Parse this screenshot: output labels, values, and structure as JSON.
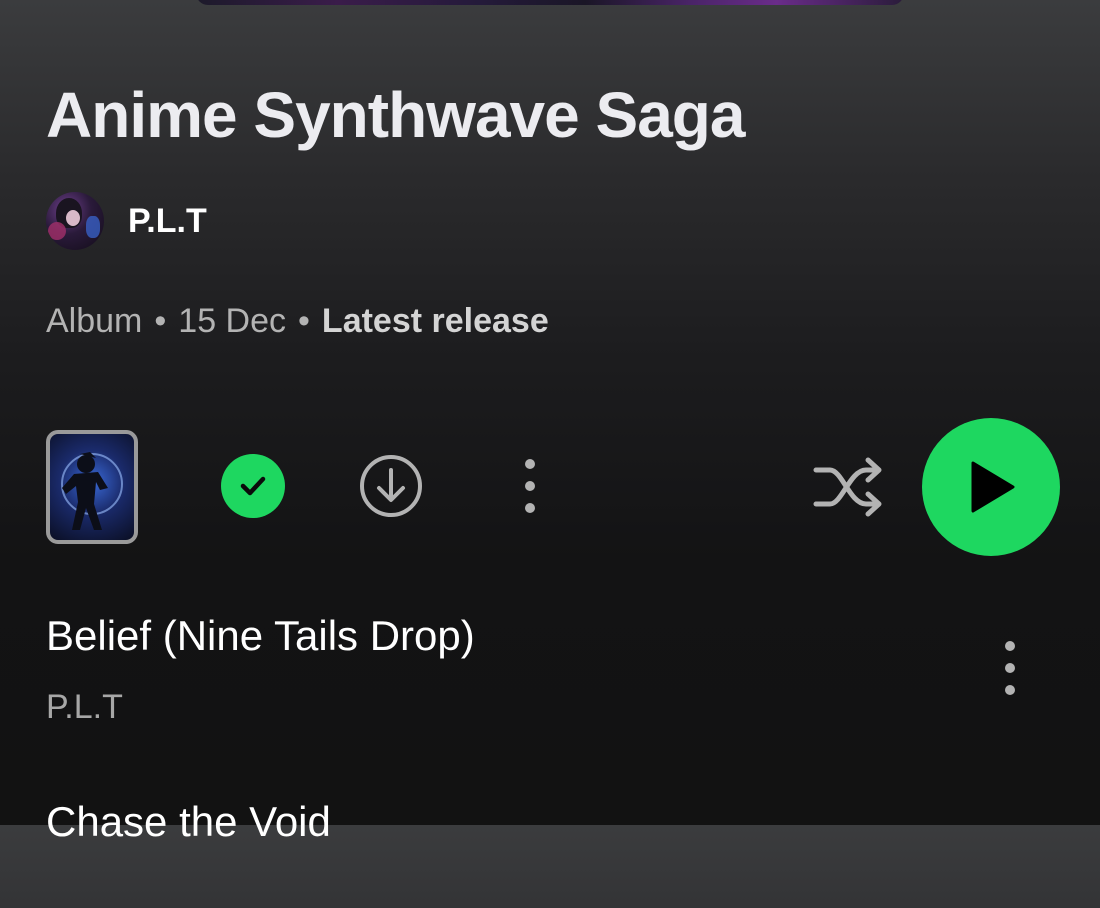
{
  "album": {
    "title": "Anime Synthwave Saga",
    "artist": "P.L.T",
    "meta": {
      "type": "Album",
      "separator": "•",
      "date": "15 Dec",
      "latest_label": "Latest release"
    }
  },
  "controls": {
    "saved": true,
    "icons": [
      "cover-thumbnail",
      "check-icon",
      "download-icon",
      "more-vertical-icon",
      "shuffle-icon",
      "play-icon"
    ]
  },
  "tracks": [
    {
      "title": "Belief (Nine Tails Drop)",
      "artist": "P.L.T"
    },
    {
      "title": "Chase the Void",
      "artist": ""
    }
  ],
  "colors": {
    "accent": "#1ed760",
    "background": "#121212",
    "text_primary": "#ffffff",
    "text_secondary": "#b3b3b3"
  }
}
